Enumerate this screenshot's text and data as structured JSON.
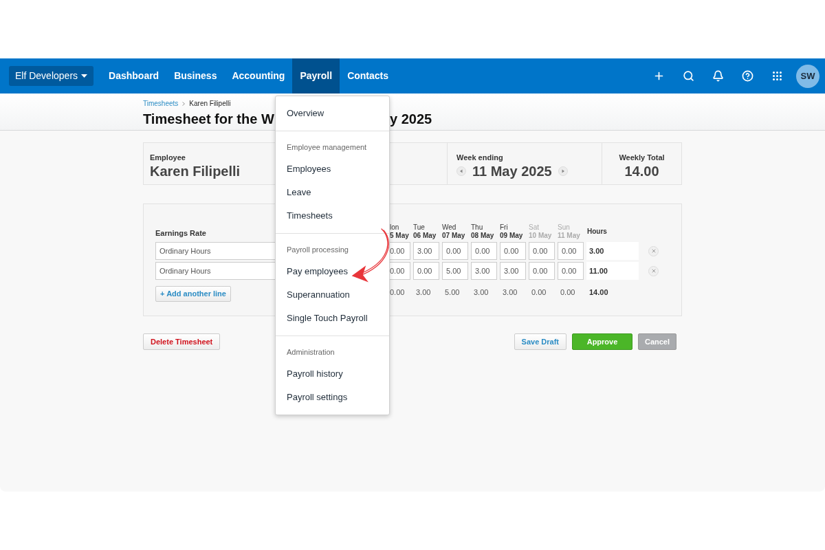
{
  "nav": {
    "org": "Elf Developers",
    "tabs": [
      {
        "label": "Dashboard",
        "selected": false
      },
      {
        "label": "Business",
        "selected": false
      },
      {
        "label": "Accounting",
        "selected": false
      },
      {
        "label": "Payroll",
        "selected": true
      },
      {
        "label": "Contacts",
        "selected": false
      }
    ],
    "avatar": "SW"
  },
  "breadcrumb": [
    {
      "label": "Timesheets",
      "kind": "link"
    },
    {
      "label": "Karen Filipelli",
      "kind": "current"
    }
  ],
  "title_parts": [
    "Timesheet for the W",
    "y 2025"
  ],
  "summary": {
    "employee_label": "Employee",
    "employee": "Karen Filipelli",
    "week_label": "Week ending",
    "week": "11 May 2025",
    "total_label": "Weekly Total",
    "total": "14.00"
  },
  "timesheet": {
    "rate_label": "Earnings Rate",
    "hours_label": "Hours",
    "days": [
      {
        "day": "lon",
        "date": "5 May",
        "weekend": false
      },
      {
        "day": "Tue",
        "date": "06 May",
        "weekend": false
      },
      {
        "day": "Wed",
        "date": "07 May",
        "weekend": false
      },
      {
        "day": "Thu",
        "date": "08 May",
        "weekend": false
      },
      {
        "day": "Fri",
        "date": "09 May",
        "weekend": false
      },
      {
        "day": "Sat",
        "date": "10 May",
        "weekend": true
      },
      {
        "day": "Sun",
        "date": "11 May",
        "weekend": true
      }
    ],
    "rows": [
      {
        "rate": "Ordinary Hours",
        "values": [
          "0.00",
          "3.00",
          "0.00",
          "0.00",
          "0.00",
          "0.00",
          "0.00"
        ],
        "hours": "3.00"
      },
      {
        "rate": "Ordinary Hours",
        "values": [
          "0.00",
          "0.00",
          "5.00",
          "3.00",
          "3.00",
          "0.00",
          "0.00"
        ],
        "hours": "11.00"
      }
    ],
    "totals": [
      "0.00",
      "3.00",
      "5.00",
      "3.00",
      "3.00",
      "0.00",
      "0.00"
    ],
    "total_hours": "14.00",
    "add_line": "+ Add another line"
  },
  "actions": {
    "delete": "Delete Timesheet",
    "save": "Save Draft",
    "approve": "Approve",
    "cancel": "Cancel"
  },
  "menu": {
    "sections": [
      {
        "items": [
          "Overview"
        ]
      },
      {
        "header": "Employee management",
        "items": [
          "Employees",
          "Leave",
          "Timesheets"
        ]
      },
      {
        "header": "Payroll processing",
        "items": [
          "Pay employees",
          "Superannuation",
          "Single Touch Payroll"
        ]
      },
      {
        "header": "Administration",
        "items": [
          "Payroll history",
          "Payroll settings"
        ]
      }
    ]
  }
}
